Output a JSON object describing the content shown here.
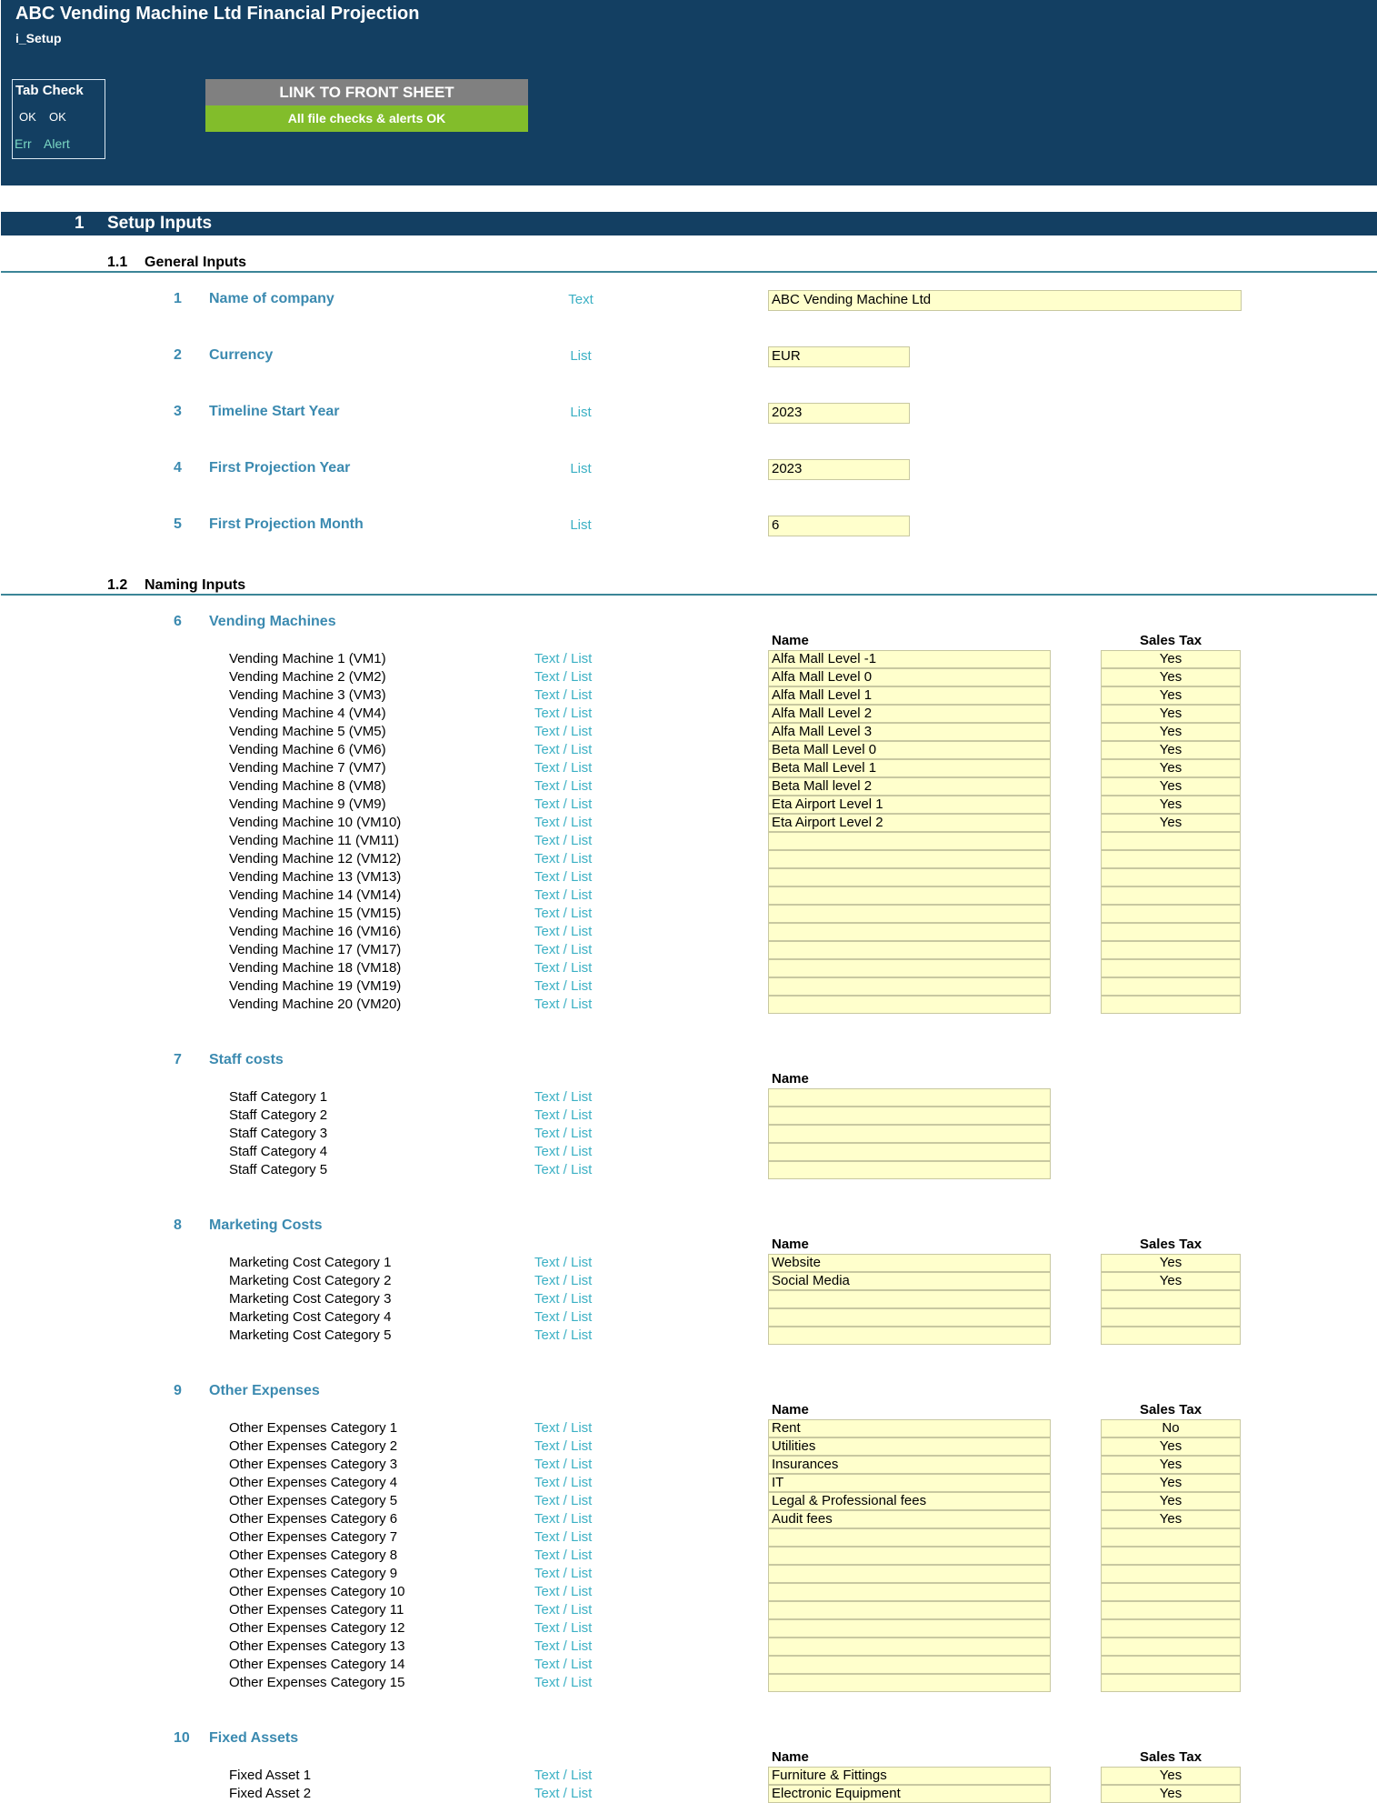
{
  "header": {
    "title": "ABC Vending Machine Ltd Financial Projection",
    "sheet": "i_Setup",
    "tab_check": {
      "title": "Tab Check",
      "ok1": "OK",
      "ok2": "OK",
      "err": "Err",
      "alert": "Alert"
    },
    "link_button": "LINK TO FRONT SHEET",
    "status": "All file checks & alerts OK"
  },
  "section": {
    "number": "1",
    "title": "Setup Inputs"
  },
  "general": {
    "number": "1.1",
    "title": "General Inputs",
    "items": [
      {
        "num": "1",
        "label": "Name of company",
        "type": "Text",
        "value": "ABC Vending Machine Ltd"
      },
      {
        "num": "2",
        "label": "Currency",
        "type": "List",
        "value": "EUR"
      },
      {
        "num": "3",
        "label": "Timeline Start Year",
        "type": "List",
        "value": "2023"
      },
      {
        "num": "4",
        "label": "First Projection Year",
        "type": "List",
        "value": "2023"
      },
      {
        "num": "5",
        "label": "First Projection Month",
        "type": "List",
        "value": "6"
      }
    ]
  },
  "naming": {
    "number": "1.2",
    "title": "Naming Inputs",
    "col_name": "Name",
    "col_tax": "Sales Tax",
    "type_label": "Text / List",
    "groups": [
      {
        "num": "6",
        "title": "Vending Machines",
        "has_tax": true,
        "rows": [
          {
            "label": "Vending Machine 1 (VM1)",
            "name": "Alfa Mall Level -1",
            "tax": "Yes"
          },
          {
            "label": "Vending Machine 2 (VM2)",
            "name": "Alfa Mall Level 0",
            "tax": "Yes"
          },
          {
            "label": "Vending Machine 3 (VM3)",
            "name": "Alfa Mall Level 1",
            "tax": "Yes"
          },
          {
            "label": "Vending Machine 4 (VM4)",
            "name": "Alfa Mall Level 2",
            "tax": "Yes"
          },
          {
            "label": "Vending Machine 5 (VM5)",
            "name": "Alfa Mall Level 3",
            "tax": "Yes"
          },
          {
            "label": "Vending Machine 6 (VM6)",
            "name": "Beta Mall Level 0",
            "tax": "Yes"
          },
          {
            "label": "Vending Machine 7 (VM7)",
            "name": "Beta Mall Level 1",
            "tax": "Yes"
          },
          {
            "label": "Vending Machine 8 (VM8)",
            "name": "Beta Mall level 2",
            "tax": "Yes"
          },
          {
            "label": "Vending Machine 9 (VM9)",
            "name": "Eta Airport Level 1",
            "tax": "Yes"
          },
          {
            "label": "Vending Machine 10 (VM10)",
            "name": "Eta Airport Level 2",
            "tax": "Yes"
          },
          {
            "label": "Vending Machine 11 (VM11)",
            "name": "",
            "tax": ""
          },
          {
            "label": "Vending Machine 12 (VM12)",
            "name": "",
            "tax": ""
          },
          {
            "label": "Vending Machine 13 (VM13)",
            "name": "",
            "tax": ""
          },
          {
            "label": "Vending Machine 14 (VM14)",
            "name": "",
            "tax": ""
          },
          {
            "label": "Vending Machine 15 (VM15)",
            "name": "",
            "tax": ""
          },
          {
            "label": "Vending Machine 16 (VM16)",
            "name": "",
            "tax": ""
          },
          {
            "label": "Vending Machine 17 (VM17)",
            "name": "",
            "tax": ""
          },
          {
            "label": "Vending Machine 18 (VM18)",
            "name": "",
            "tax": ""
          },
          {
            "label": "Vending Machine 19 (VM19)",
            "name": "",
            "tax": ""
          },
          {
            "label": "Vending Machine 20 (VM20)",
            "name": "",
            "tax": ""
          }
        ]
      },
      {
        "num": "7",
        "title": "Staff costs",
        "has_tax": false,
        "rows": [
          {
            "label": "Staff Category 1",
            "name": ""
          },
          {
            "label": "Staff Category 2",
            "name": ""
          },
          {
            "label": "Staff Category 3",
            "name": ""
          },
          {
            "label": "Staff Category 4",
            "name": ""
          },
          {
            "label": "Staff Category 5",
            "name": ""
          }
        ]
      },
      {
        "num": "8",
        "title": "Marketing Costs",
        "has_tax": true,
        "rows": [
          {
            "label": "Marketing Cost Category 1",
            "name": "Website",
            "tax": "Yes"
          },
          {
            "label": "Marketing Cost Category 2",
            "name": "Social Media",
            "tax": "Yes"
          },
          {
            "label": "Marketing Cost Category 3",
            "name": "",
            "tax": ""
          },
          {
            "label": "Marketing Cost Category 4",
            "name": "",
            "tax": ""
          },
          {
            "label": "Marketing Cost Category 5",
            "name": "",
            "tax": ""
          }
        ]
      },
      {
        "num": "9",
        "title": "Other Expenses",
        "has_tax": true,
        "rows": [
          {
            "label": "Other Expenses Category 1",
            "name": "Rent",
            "tax": "No"
          },
          {
            "label": "Other Expenses Category 2",
            "name": "Utilities",
            "tax": "Yes"
          },
          {
            "label": "Other Expenses Category 3",
            "name": "Insurances",
            "tax": "Yes"
          },
          {
            "label": "Other Expenses Category 4",
            "name": "IT",
            "tax": "Yes"
          },
          {
            "label": "Other Expenses Category 5",
            "name": "Legal & Professional fees",
            "tax": "Yes"
          },
          {
            "label": "Other Expenses Category 6",
            "name": "Audit fees",
            "tax": "Yes"
          },
          {
            "label": "Other Expenses Category 7",
            "name": "",
            "tax": ""
          },
          {
            "label": "Other Expenses Category 8",
            "name": "",
            "tax": ""
          },
          {
            "label": "Other Expenses Category 9",
            "name": "",
            "tax": ""
          },
          {
            "label": "Other Expenses Category 10",
            "name": "",
            "tax": ""
          },
          {
            "label": "Other Expenses Category 11",
            "name": "",
            "tax": ""
          },
          {
            "label": "Other Expenses Category 12",
            "name": "",
            "tax": ""
          },
          {
            "label": "Other Expenses Category 13",
            "name": "",
            "tax": ""
          },
          {
            "label": "Other Expenses Category 14",
            "name": "",
            "tax": ""
          },
          {
            "label": "Other Expenses Category 15",
            "name": "",
            "tax": ""
          }
        ]
      },
      {
        "num": "10",
        "title": "Fixed Assets",
        "has_tax": true,
        "rows": [
          {
            "label": "Fixed Asset 1",
            "name": "Furniture & Fittings",
            "tax": "Yes"
          },
          {
            "label": "Fixed Asset 2",
            "name": "Electronic Equipment",
            "tax": "Yes"
          }
        ]
      }
    ]
  }
}
